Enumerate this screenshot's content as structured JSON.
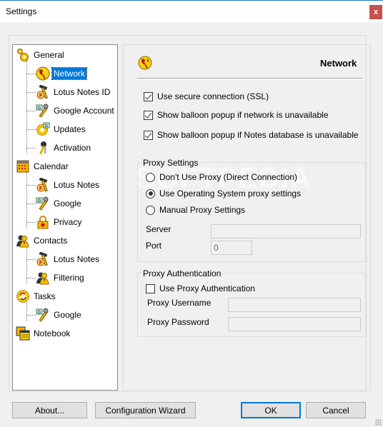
{
  "window": {
    "title": "Settings",
    "close_label": "x"
  },
  "tree": {
    "items": [
      {
        "label": "General",
        "icon": "gears-icon",
        "level": 0
      },
      {
        "label": "Network",
        "icon": "globe-icon",
        "level": 1,
        "selected": true
      },
      {
        "label": "Lotus Notes ID",
        "icon": "lotus-hammer-icon",
        "level": 1
      },
      {
        "label": "Google Account",
        "icon": "google-wrench-icon",
        "level": 1
      },
      {
        "label": "Updates",
        "icon": "updates-gear-icon",
        "level": 1
      },
      {
        "label": "Activation",
        "icon": "keys-icon",
        "level": 1
      },
      {
        "label": "Calendar",
        "icon": "calendar-icon",
        "level": 0
      },
      {
        "label": "Lotus Notes",
        "icon": "lotus-hammer-icon",
        "level": 1
      },
      {
        "label": "Google",
        "icon": "google-wrench-icon",
        "level": 1
      },
      {
        "label": "Privacy",
        "icon": "padlock-icon",
        "level": 1
      },
      {
        "label": "Contacts",
        "icon": "contacts-icon",
        "level": 0
      },
      {
        "label": "Lotus Notes",
        "icon": "lotus-hammer-icon",
        "level": 1
      },
      {
        "label": "Filtering",
        "icon": "contacts-icon",
        "level": 1
      },
      {
        "label": "Tasks",
        "icon": "tasks-gear-icon",
        "level": 0
      },
      {
        "label": "Google",
        "icon": "google-wrench-icon",
        "level": 1
      },
      {
        "label": "Notebook",
        "icon": "notebook-icon",
        "level": 0
      }
    ]
  },
  "panel": {
    "title": "Network",
    "icon": "globe-icon",
    "options": [
      {
        "label": "Use secure connection (SSL)",
        "checked": true
      },
      {
        "label": "Show balloon popup if network is unavailable",
        "checked": true
      },
      {
        "label": "Show balloon popup if Notes database is unavailable",
        "checked": true
      }
    ],
    "proxy_settings": {
      "legend": "Proxy Settings",
      "radios": [
        {
          "label": "Don't Use Proxy (Direct Connection)",
          "selected": false
        },
        {
          "label": "Use Operating System proxy settings",
          "selected": true
        },
        {
          "label": "Manual Proxy Settings",
          "selected": false
        }
      ],
      "server_label": "Server",
      "server_value": "",
      "port_label": "Port",
      "port_value": "0"
    },
    "proxy_auth": {
      "legend": "Proxy Authentication",
      "use_auth_label": "Use Proxy Authentication",
      "use_auth_checked": false,
      "username_label": "Proxy Username",
      "username_value": "",
      "password_label": "Proxy Password",
      "password_value": ""
    }
  },
  "buttons": {
    "about": "About...",
    "wizard": "Configuration Wizard",
    "ok": "OK",
    "cancel": "Cancel"
  },
  "watermark": "SOFTPEDIA",
  "colors": {
    "selection": "#0078d7",
    "close": "#c75050",
    "titlebar_accent": "#1979ca"
  }
}
